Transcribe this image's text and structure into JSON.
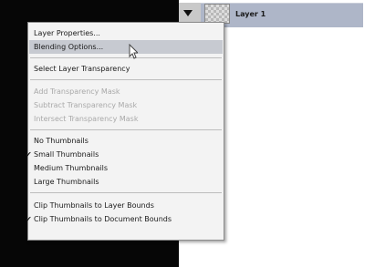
{
  "layers_panel": {
    "layer_name": "Layer 1"
  },
  "menu": {
    "items": [
      {
        "label": "Layer Properties...",
        "enabled": true,
        "checked": false
      },
      {
        "label": "Blending Options...",
        "enabled": true,
        "checked": false,
        "highlighted": true
      },
      {
        "label": "Select Layer Transparency",
        "enabled": true,
        "checked": false
      },
      {
        "label": "Add Transparency Mask",
        "enabled": false,
        "checked": false
      },
      {
        "label": "Subtract Transparency Mask",
        "enabled": false,
        "checked": false
      },
      {
        "label": "Intersect Transparency Mask",
        "enabled": false,
        "checked": false
      },
      {
        "label": "No Thumbnails",
        "enabled": true,
        "checked": false
      },
      {
        "label": "Small Thumbnails",
        "enabled": true,
        "checked": true
      },
      {
        "label": "Medium Thumbnails",
        "enabled": true,
        "checked": false
      },
      {
        "label": "Large Thumbnails",
        "enabled": true,
        "checked": false
      },
      {
        "label": "Clip Thumbnails to Layer Bounds",
        "enabled": true,
        "checked": false
      },
      {
        "label": "Clip Thumbnails to Document Bounds",
        "enabled": true,
        "checked": true
      }
    ],
    "check_glyph": "✔"
  },
  "colors": {
    "menu_bg": "#f3f3f3",
    "highlight": "#c7cad1",
    "layer_row": "#aeb6c8",
    "left_panel": "#060606"
  },
  "icons": {
    "visibility": "eye-icon",
    "pointer": "mouse-pointer-icon"
  }
}
